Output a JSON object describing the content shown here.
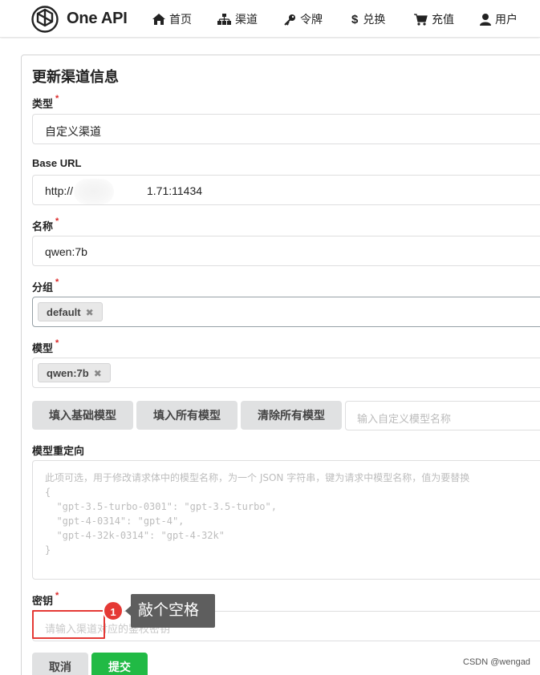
{
  "header": {
    "brand": "One API",
    "nav": [
      {
        "label": "首页",
        "icon": "home-icon"
      },
      {
        "label": "渠道",
        "icon": "sitemap-icon"
      },
      {
        "label": "令牌",
        "icon": "key-icon"
      },
      {
        "label": "兑换",
        "icon": "dollar-icon"
      },
      {
        "label": "充值",
        "icon": "cart-icon"
      },
      {
        "label": "用户",
        "icon": "user-icon"
      }
    ]
  },
  "form": {
    "title": "更新渠道信息",
    "required_mark": "*",
    "type": {
      "label": "类型",
      "value": "自定义渠道"
    },
    "base_url": {
      "label": "Base URL",
      "value_prefix": "http://",
      "value_suffix": "1.71:11434"
    },
    "name": {
      "label": "名称",
      "value": "qwen:7b"
    },
    "group": {
      "label": "分组",
      "chips": [
        "default"
      ]
    },
    "models": {
      "label": "模型",
      "chips": [
        "qwen:7b"
      ]
    },
    "model_buttons": {
      "fill_basic": "填入基础模型",
      "fill_all": "填入所有模型",
      "clear_all": "清除所有模型",
      "custom_placeholder": "输入自定义模型名称"
    },
    "model_mapping": {
      "label": "模型重定向",
      "placeholder_lines": [
        "此项可选，用于修改请求体中的模型名称，为一个 JSON 字符串，键为请求中模型名称，值为要替换",
        "{",
        "  \"gpt-3.5-turbo-0301\": \"gpt-3.5-turbo\",",
        "  \"gpt-4-0314\": \"gpt-4\",",
        "  \"gpt-4-32k-0314\": \"gpt-4-32k\"",
        "}"
      ]
    },
    "key": {
      "label": "密钥",
      "placeholder": "请输入渠道对应的鉴权密钥"
    },
    "cancel": "取消",
    "submit": "提交"
  },
  "annotation": {
    "badge": "1",
    "tooltip": "敲个空格"
  },
  "watermark": "CSDN @wengad"
}
